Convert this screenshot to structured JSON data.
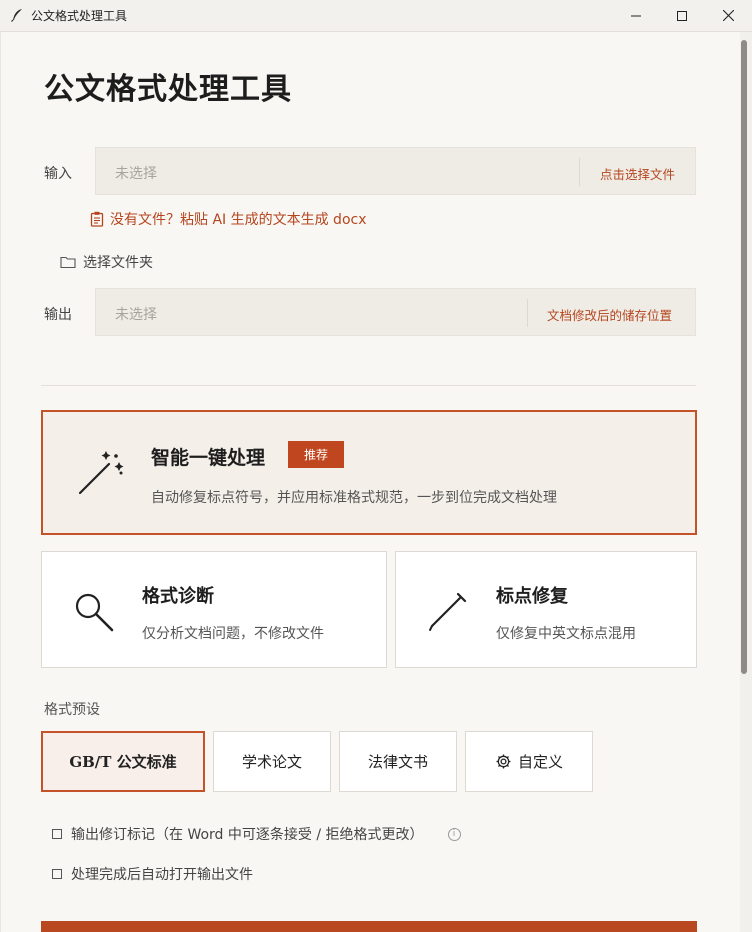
{
  "window": {
    "title": "公文格式处理工具",
    "icon": "quill-feather-icon",
    "controls": {
      "minimize": "─",
      "maximize": "☐",
      "close": "✕"
    }
  },
  "page": {
    "heading": "公文格式处理工具"
  },
  "input": {
    "label": "输入",
    "placeholder": "未选择",
    "action": "点击选择文件"
  },
  "generate_link": {
    "icon": "clipboard-document-icon",
    "label": "没有文件？粘贴 AI 生成的文本生成 docx"
  },
  "folder": {
    "icon": "folder-icon",
    "label": "选择文件夹"
  },
  "output": {
    "label": "输出",
    "placeholder": "未选择",
    "action": "文档修改后的储存位置"
  },
  "primary_card": {
    "icon": "magic-wand-icon",
    "title": "智能一键处理",
    "badge": "推荐",
    "description": "自动修复标点符号，并应用标准格式规范，一步到位完成文档处理"
  },
  "cards": [
    {
      "icon": "magnifier-icon",
      "title": "格式诊断",
      "description": "仅分析文档问题，不修改文件"
    },
    {
      "icon": "pen-icon",
      "title": "标点修复",
      "description": "仅修复中英文标点混用"
    }
  ],
  "presets": {
    "label": "格式预设",
    "options": [
      "GB/T 公文标准",
      "学术论文",
      "法律文书",
      "自定义"
    ],
    "selected": "GB/T 公文标准",
    "custom_icon": "gear-icon"
  },
  "options": {
    "track_changes": "输出修订标记（在 Word 中可逐条接受 / 拒绝格式更改）",
    "auto_open": "处理完成后自动打开输出文件",
    "info_icon": "info-icon"
  },
  "colors": {
    "accent": "#c0461f",
    "background": "#f9f7f4",
    "field": "#efece6"
  }
}
